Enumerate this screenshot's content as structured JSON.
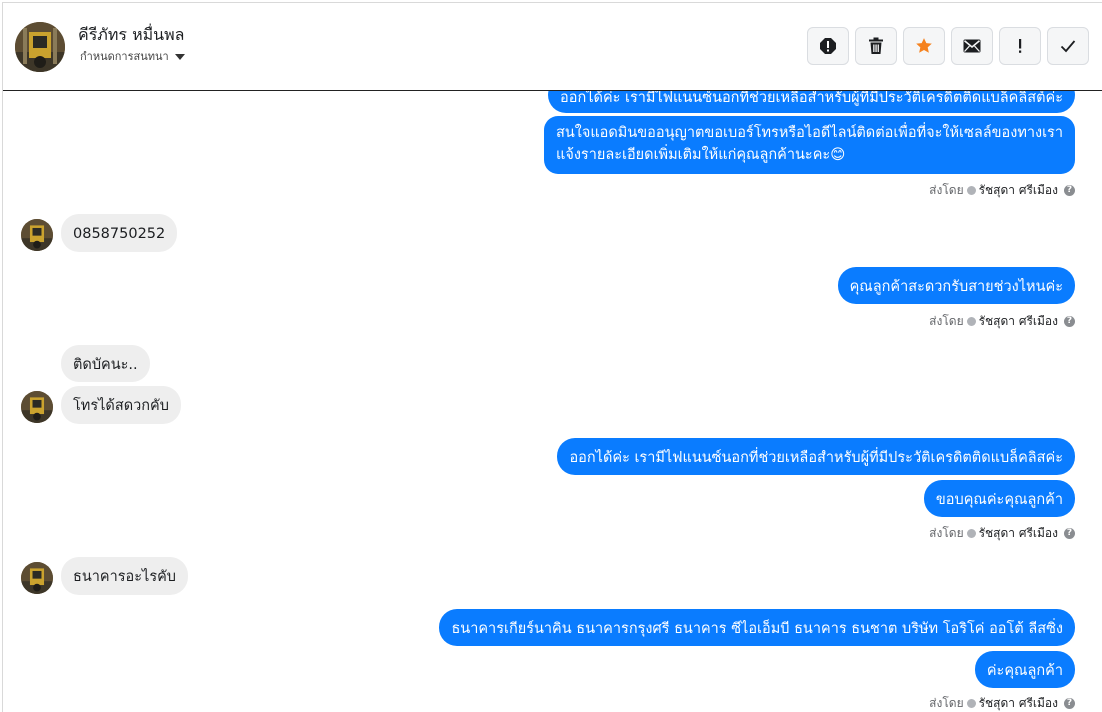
{
  "header": {
    "contact_name": "คีรีภัทร หมื่นพล",
    "assign_label": "กำหนดการสนทนา",
    "actions": [
      {
        "name": "report-icon"
      },
      {
        "name": "trash-icon"
      },
      {
        "name": "star-icon"
      },
      {
        "name": "envelope-icon"
      },
      {
        "name": "exclamation-icon"
      },
      {
        "name": "check-icon"
      }
    ]
  },
  "colors": {
    "outgoing_bubble": "#0a7cff",
    "incoming_bubble": "#eeeeee",
    "star": "#f5821f"
  },
  "messages": {
    "m0": "ออกได้ค่ะ เรามีไฟแนนซ์นอกที่ช่วยเหลือสำหรับผู้ที่มีประวัติเครดิตติดแบล็คลิสต์ค่ะ",
    "m1_line1": "สนใจแอดมินขออนุญาตขอเบอร์โทรหรือไอดีไลน์ติดต่อเพื่อที่จะให้เซลล์ของทางเรา",
    "m1_line2": "แจ้งรายละเอียดเพิ่มเติมให้แก่คุณลูกค้านะคะ😊",
    "m2": "0858750252",
    "m3": "คุณลูกค้าสะดวกรับสายช่วงไหนค่ะ",
    "m4": "ติดบัคนะ..",
    "m5": "โทรได้สดวกคับ",
    "m6": "ออกได้ค่ะ เรามีไฟแนนซ์นอกที่ช่วยเหลือสำหรับผู้ที่มีประวัติเครดิตติดแบล็คลิสค่ะ",
    "m7": "ขอบคุณค่ะคุณลูกค้า",
    "m8": "ธนาคารอะไรคับ",
    "m9": "ธนาคารเกียร์นาคิน  ธนาคารกรุงศรี  ธนาคาร ซีไอเอ็มบี ธนาคาร ธนชาต  บริษัท โอริโค่ ออโต้ ลีสซิ่ง",
    "m10": "ค่ะคุณลูกค้า"
  },
  "meta": {
    "sent_by": "ส่งโดย",
    "agent": "รัชสุดา ศรีเมือง"
  }
}
